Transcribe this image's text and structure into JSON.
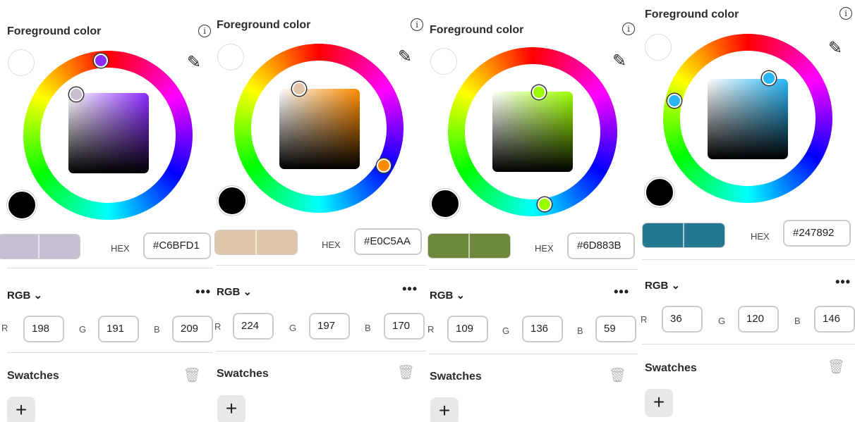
{
  "panels": [
    {
      "title": "Foreground color",
      "hex_label": "HEX",
      "hex": "#C6BFD1",
      "hue_color": "#8a2bff",
      "color_model": "RGB",
      "rgb": {
        "r_label": "R",
        "r": "198",
        "g_label": "G",
        "g": "191",
        "b_label": "B",
        "b": "209"
      },
      "swatches_label": "Swatches",
      "add_label": "+",
      "more_label": "•••"
    },
    {
      "title": "Foreground color",
      "hex_label": "HEX",
      "hex": "#E0C5AA",
      "hue_color": "#ff8c00",
      "color_model": "RGB",
      "rgb": {
        "r_label": "R",
        "r": "224",
        "g_label": "G",
        "g": "197",
        "b_label": "B",
        "b": "170"
      },
      "swatches_label": "Swatches",
      "add_label": "+",
      "more_label": "•••"
    },
    {
      "title": "Foreground color",
      "hex_label": "HEX",
      "hex": "#6D883B",
      "hue_color": "#9cff00",
      "color_model": "RGB",
      "rgb": {
        "r_label": "R",
        "r": "109",
        "g_label": "G",
        "g": "136",
        "b_label": "B",
        "b": "59"
      },
      "swatches_label": "Swatches",
      "add_label": "+",
      "more_label": "•••"
    },
    {
      "title": "Foreground color",
      "hex_label": "HEX",
      "hex": "#247892",
      "hue_color": "#29b6f6",
      "color_model": "RGB",
      "rgb": {
        "r_label": "R",
        "r": "36",
        "g_label": "G",
        "g": "120",
        "b_label": "B",
        "b": "146"
      },
      "swatches_label": "Swatches",
      "add_label": "+",
      "more_label": "•••"
    }
  ]
}
